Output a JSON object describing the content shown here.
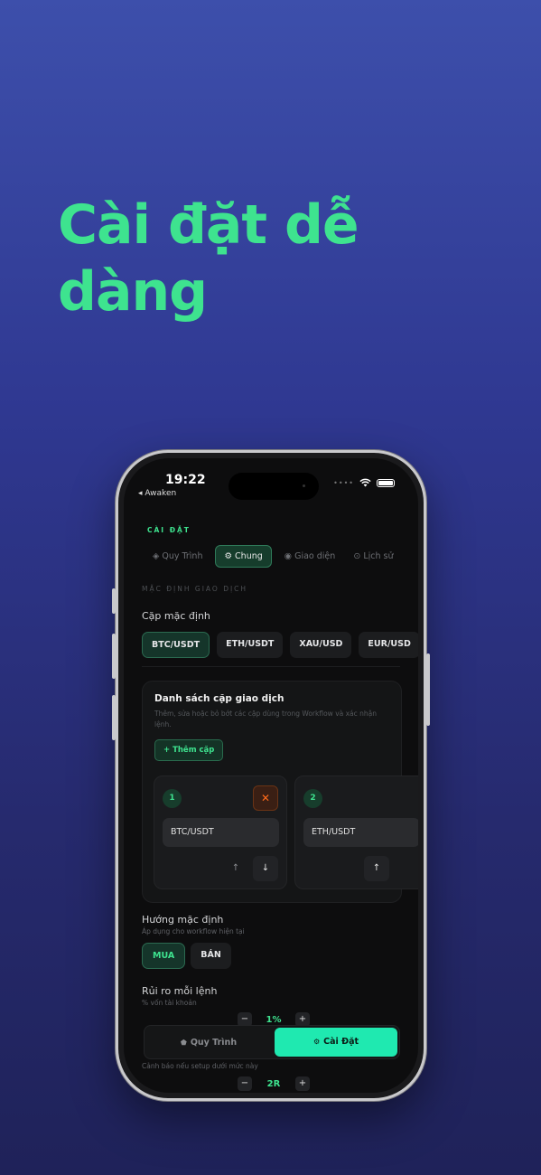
{
  "headline": "Cài đặt dễ dàng",
  "phone": {
    "status": {
      "time": "19:22",
      "back": "◂ Awaken",
      "signal": "••••"
    },
    "section_label": "CÀI ĐẶT",
    "tabs": [
      {
        "icon": "◈",
        "label": "Quy Trình"
      },
      {
        "icon": "⚙",
        "label": "Chung"
      },
      {
        "icon": "◉",
        "label": "Giao diện"
      },
      {
        "icon": "⊙",
        "label": "Lịch sử"
      }
    ],
    "sub_label": "MẶC ĐỊNH GIAO DỊCH",
    "default_pair": {
      "title": "Cặp mặc định",
      "options": [
        "BTC/USDT",
        "ETH/USDT",
        "XAU/USD",
        "EUR/USD"
      ],
      "selected": "BTC/USDT"
    },
    "pair_list": {
      "title": "Danh sách cặp giao dịch",
      "description": "Thêm, sửa hoặc bỏ bớt các cặp dùng trong Workflow và xác nhận lệnh.",
      "add_label": "+ Thêm cặp",
      "slots": [
        {
          "number": "1",
          "value": "BTC/USDT",
          "remove": "✕",
          "up": "↑",
          "down": "↓"
        },
        {
          "number": "2",
          "value": "ETH/USDT",
          "up": "↑"
        }
      ]
    },
    "direction": {
      "title": "Hướng mặc định",
      "subtitle": "Áp dụng cho workflow hiện tại",
      "options": [
        "MUA",
        "BÁN"
      ],
      "selected": "MUA"
    },
    "risk": {
      "title": "Rủi ro mỗi lệnh",
      "subtitle": "% vốn tài khoản",
      "value": "1%",
      "minus": "−",
      "plus": "+"
    },
    "rr": {
      "subtitle": "Cảnh báo nếu setup dưới mức này",
      "value": "2R",
      "minus": "−",
      "plus": "+"
    },
    "bottom_nav": {
      "left": {
        "icon": "⬟",
        "label": "Quy Trình"
      },
      "right": {
        "icon": "⚙",
        "label": "Cài Đặt"
      }
    }
  }
}
